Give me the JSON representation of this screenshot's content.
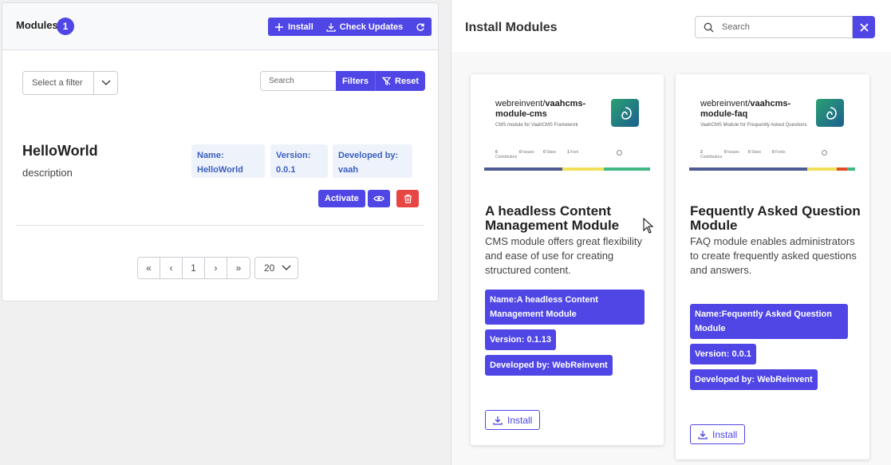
{
  "left": {
    "title": "Modules",
    "count": "1",
    "toolbar": {
      "install_label": "Install",
      "check_updates_label": "Check Updates"
    },
    "filter_select": {
      "selected": "Select a filter"
    },
    "search": {
      "placeholder": "Search"
    },
    "filters_label": "Filters",
    "reset_label": "Reset",
    "module": {
      "name": "HelloWorld",
      "description": "description",
      "meta": [
        {
          "label": "Name:",
          "value": "HelloWorld"
        },
        {
          "label": "Version:",
          "value": "0.0.1"
        },
        {
          "label": "Developed by:",
          "value": "vaah"
        }
      ],
      "activate_label": "Activate"
    },
    "pagination": {
      "first": "«",
      "prev": "‹",
      "current": "1",
      "next": "›",
      "last": "»",
      "per_page": "20"
    }
  },
  "right": {
    "title": "Install Modules",
    "search": {
      "placeholder": "Search"
    },
    "cards": [
      {
        "repo_owner": "webreinvent/",
        "repo_name_1": "vaahcms-",
        "repo_name_2": "module-cms",
        "tagline": "CMS module for VaahCMS Framework",
        "stats": [
          {
            "value": "6",
            "label": "Contributors"
          },
          {
            "value": "0",
            "label": "Issues"
          },
          {
            "value": "0",
            "label": "Stars"
          },
          {
            "value": "1",
            "label": "Fork"
          }
        ],
        "title": "A headless Content Management Module",
        "description": "CMS module offers great flexibility and ease of use for creating structured content.",
        "name_pill": "Name:A headless Content Management Module",
        "version_pill": "Version: 0.1.13",
        "developer_pill": "Developed by: WebReinvent",
        "install_label": "Install"
      },
      {
        "repo_owner": "webreinvent/",
        "repo_name_1": "vaahcms-",
        "repo_name_2": "module-faq",
        "tagline": "VaahCMS Module for Frequently Asked Questions",
        "stats": [
          {
            "value": "2",
            "label": "Contributors"
          },
          {
            "value": "0",
            "label": "Issues"
          },
          {
            "value": "0",
            "label": "Stars"
          },
          {
            "value": "0",
            "label": "Forks"
          }
        ],
        "title": "Fequently Asked Question Module",
        "description": "FAQ module enables administrators to create frequently asked questions and answers.",
        "name_pill": "Name:Fequently Asked Question Module",
        "version_pill": "Version: 0.0.1",
        "developer_pill": "Developed by: WebReinvent",
        "install_label": "Install"
      }
    ]
  },
  "colors": {
    "primary": "#4f46e5",
    "danger": "#e84545",
    "meta_bg": "#eef2fb"
  }
}
